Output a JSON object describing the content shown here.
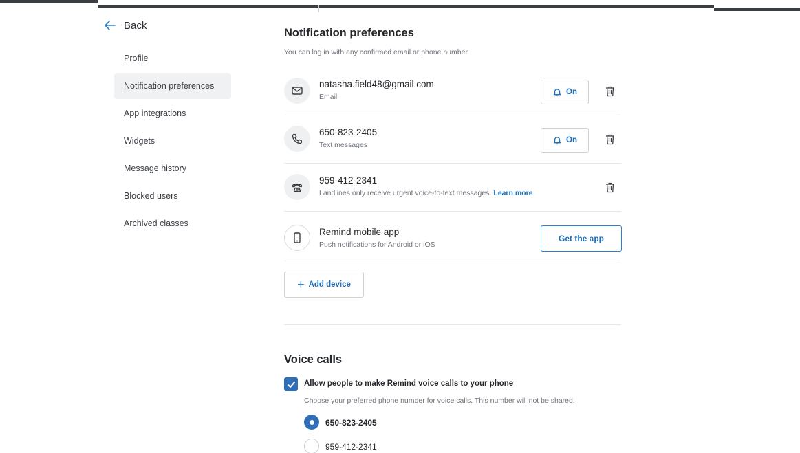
{
  "sidebar": {
    "back_label": "Back",
    "items": [
      {
        "label": "Profile"
      },
      {
        "label": "Notification preferences"
      },
      {
        "label": "App integrations"
      },
      {
        "label": "Widgets"
      },
      {
        "label": "Message history"
      },
      {
        "label": "Blocked users"
      },
      {
        "label": "Archived classes"
      }
    ],
    "active_item": "Notification preferences"
  },
  "notifications": {
    "title": "Notification preferences",
    "subtitle": "You can log in with any confirmed email or phone number.",
    "devices": [
      {
        "icon": "envelope-icon",
        "primary": "natasha.field48@gmail.com",
        "secondary": "Email",
        "button_label": "On"
      },
      {
        "icon": "phone-icon",
        "primary": "650-823-2405",
        "secondary": "Text messages",
        "button_label": "On"
      },
      {
        "icon": "landline-icon",
        "primary": "959-412-2341",
        "secondary": "Landlines only receive urgent voice-to-text messages.",
        "link": "Learn more"
      },
      {
        "icon": "mobile-device-icon",
        "primary": "Remind mobile app",
        "secondary": "Push notifications for Android or iOS",
        "button_label": "Get the app"
      }
    ],
    "add_device_label": "Add device"
  },
  "voice_calls": {
    "title": "Voice calls",
    "checkbox_label": "Allow people to make Remind voice calls to your phone",
    "checkbox_checked": true,
    "description": "Choose your preferred phone number for voice calls. This number will not be shared.",
    "options": [
      {
        "label": "650-823-2405",
        "selected": true
      },
      {
        "label": "959-412-2341",
        "selected": false
      }
    ]
  },
  "colors": {
    "accent": "#2f6fb8",
    "link": "#1f6fb8",
    "active_nav_bg": "#f0f1f3",
    "top_bar": "#3a3d42"
  }
}
